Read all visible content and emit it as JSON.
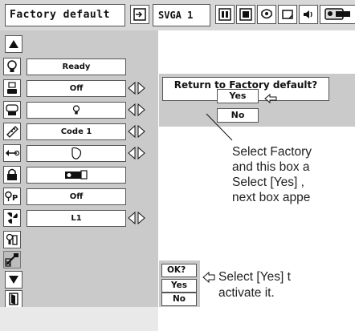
{
  "menu_bar": {
    "title": "Factory default",
    "input_signal": "SVGA 1",
    "icons": [
      "input-icon",
      "pc-adjust-icon",
      "image-select-icon",
      "image-adjust-icon",
      "screen-icon",
      "sound-icon",
      "setting-icon"
    ]
  },
  "setting_menu": {
    "items": [
      {
        "icon": "light-bulb-icon",
        "value": "Ready",
        "has_arrows": false
      },
      {
        "icon": "ceiling-mount-icon",
        "value": "Off",
        "has_arrows": true
      },
      {
        "icon": "lamp-control-icon",
        "value": "♀",
        "has_arrows": true
      },
      {
        "icon": "remote-control-icon",
        "value": "Code 1",
        "has_arrows": true
      },
      {
        "icon": "pointer-icon",
        "value": "",
        "has_arrows": true
      },
      {
        "icon": "security-lock-icon",
        "value": "",
        "has_arrows": false
      },
      {
        "icon": "power-management-icon",
        "value": "Off",
        "has_arrows": false
      },
      {
        "icon": "fan-control-icon",
        "value": "L1",
        "has_arrows": true
      },
      {
        "icon": "filter-counter-icon",
        "value": "",
        "has_arrows": false
      },
      {
        "icon": "factory-default-icon",
        "value": "",
        "has_arrows": false
      }
    ]
  },
  "dialog1": {
    "question": "Return to Factory default?",
    "yes": "Yes",
    "no": "No"
  },
  "dialog2": {
    "question": "OK?",
    "yes": "Yes",
    "no": "No"
  },
  "instructions": {
    "first": [
      "Select Factory",
      "and this box a",
      "Select [Yes] ,",
      "next box appe"
    ],
    "second": [
      "Select [Yes] t",
      "activate it."
    ]
  }
}
